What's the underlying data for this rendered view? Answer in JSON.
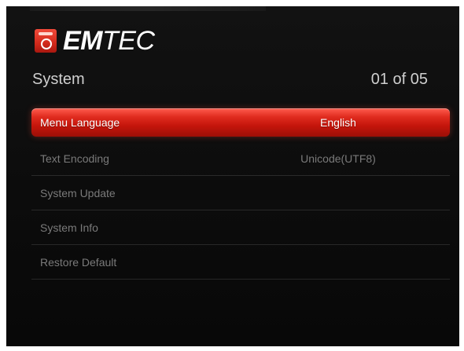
{
  "brand": {
    "logo_bold": "EM",
    "logo_light": "TEC",
    "logo_mark_icon": "emtec-logo-icon",
    "accent_color": "#d8281c"
  },
  "header": {
    "title": "System",
    "page_counter": "01 of 05"
  },
  "menu": {
    "items": [
      {
        "label": "Menu Language",
        "value": "English",
        "selected": true
      },
      {
        "label": "Text Encoding",
        "value": "Unicode(UTF8)",
        "selected": false
      },
      {
        "label": "System Update",
        "value": "",
        "selected": false
      },
      {
        "label": "System Info",
        "value": "",
        "selected": false
      },
      {
        "label": "Restore Default",
        "value": "",
        "selected": false
      }
    ]
  }
}
